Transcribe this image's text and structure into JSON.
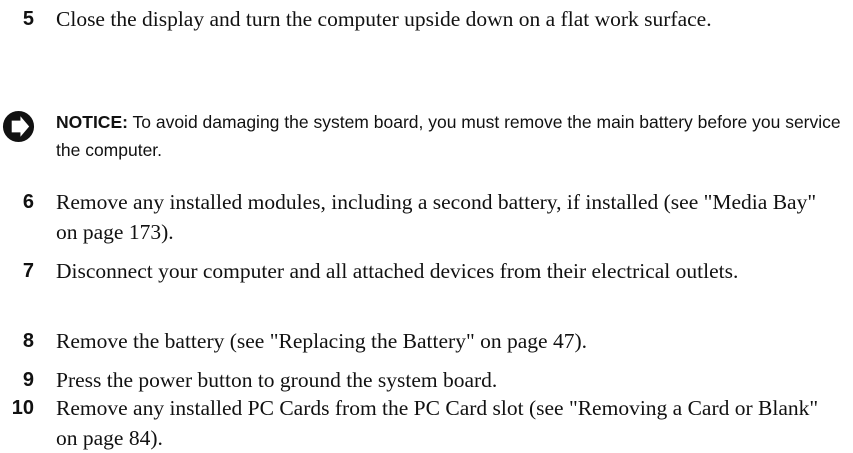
{
  "steps": [
    {
      "number": "5",
      "text": "Close the display and turn the computer upside down on a flat work surface."
    },
    {
      "number": "6",
      "text": "Remove any installed modules, including a second battery, if installed (see \"Media Bay\" on page 173)."
    },
    {
      "number": "7",
      "text": "Disconnect your computer and all attached devices from their electrical outlets."
    },
    {
      "number": "8",
      "text": "Remove the battery (see \"Replacing the Battery\" on page 47)."
    },
    {
      "number": "9",
      "text": "Press the power button to ground the system board."
    },
    {
      "number": "10",
      "text": "Remove any installed PC Cards from the PC Card slot (see \"Removing a Card or Blank\" on page 84)."
    }
  ],
  "notice": {
    "label": "NOTICE:",
    "text": "To avoid damaging the system board, you must remove the main battery before you service the computer.",
    "icon": "notice-icon"
  }
}
